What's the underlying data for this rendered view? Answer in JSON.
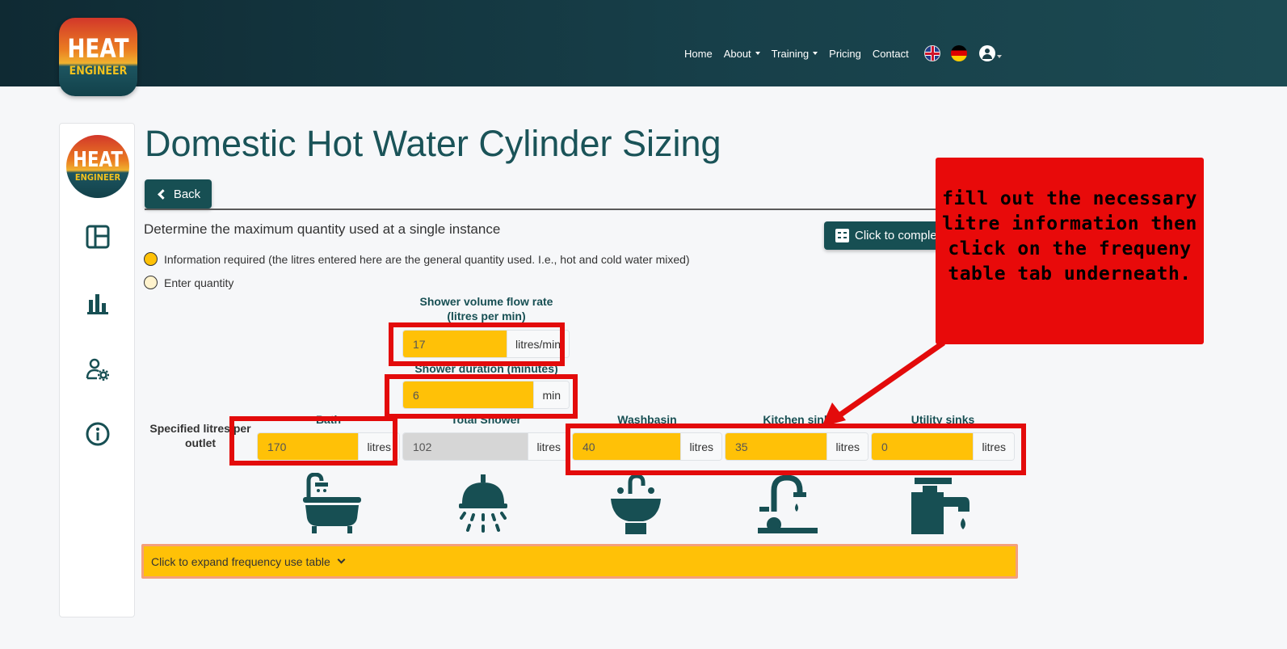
{
  "header": {
    "logo_line1": "HEAT",
    "logo_line2": "ENGINEER",
    "nav": [
      {
        "label": "Home",
        "dropdown": false
      },
      {
        "label": "About",
        "dropdown": true
      },
      {
        "label": "Training",
        "dropdown": true
      },
      {
        "label": "Pricing",
        "dropdown": false
      },
      {
        "label": "Contact",
        "dropdown": false
      }
    ]
  },
  "sidebar": {
    "logo_line1": "HEAT",
    "logo_line2": "ENGINEER",
    "icons": [
      "dashboard-icon",
      "bar-chart-icon",
      "user-settings-icon",
      "info-icon"
    ]
  },
  "main": {
    "title": "Domestic Hot Water Cylinder Sizing",
    "back_label": "Back",
    "subtitle": "Determine the maximum quantity used at a single instance",
    "complete_label": "Click to complete",
    "legend_required": "Information required (the litres entered here are the general quantity used. I.e., hot and cold water mixed)",
    "legend_quantity": "Enter quantity",
    "shower_flow": {
      "label_line1": "Shower volume flow rate",
      "label_line2": "(litres per min)",
      "value": "17",
      "unit": "litres/min"
    },
    "shower_duration": {
      "label": "Shower duration (minutes)",
      "value": "6",
      "unit": "min"
    },
    "outlet_label": "Specified litres per outlet",
    "outlets": [
      {
        "label": "Bath",
        "value": "170",
        "unit": "litres"
      },
      {
        "label": "Total Shower",
        "value": "102",
        "unit": "litres"
      },
      {
        "label": "Washbasin",
        "value": "40",
        "unit": "litres"
      },
      {
        "label": "Kitchen sink",
        "value": "35",
        "unit": "litres"
      },
      {
        "label": "Utility sinks",
        "value": "0",
        "unit": "litres"
      }
    ],
    "expand_label": "Click to expand frequency use table"
  },
  "annotation": {
    "text": "fill out the necessary\nlitre information then\nclick on the frequeny\ntable tab underneath."
  },
  "colors": {
    "primary": "#174f53",
    "required": "#ffc107",
    "annotation_red": "#e30b0b"
  }
}
